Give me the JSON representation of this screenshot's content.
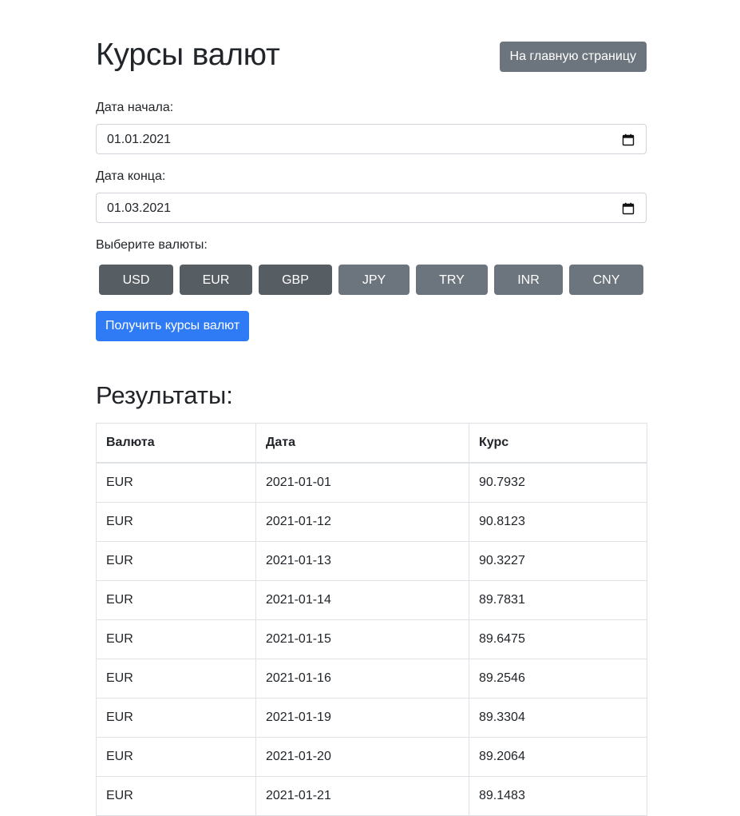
{
  "page": {
    "title": "Курсы валют",
    "home_button": "На главную страницу"
  },
  "form": {
    "start_label": "Дата начала:",
    "start_value": "01.01.2021",
    "end_label": "Дата конца:",
    "end_value": "01.03.2021",
    "currency_label": "Выберите валюты:",
    "currencies": [
      {
        "code": "USD",
        "selected": true
      },
      {
        "code": "EUR",
        "selected": true
      },
      {
        "code": "GBP",
        "selected": true
      },
      {
        "code": "JPY",
        "selected": false
      },
      {
        "code": "TRY",
        "selected": false
      },
      {
        "code": "INR",
        "selected": false
      },
      {
        "code": "CNY",
        "selected": false
      }
    ],
    "submit_button": "Получить курсы валют"
  },
  "results": {
    "title": "Результаты:",
    "columns": [
      "Валюта",
      "Дата",
      "Курс"
    ],
    "rows": [
      [
        "EUR",
        "2021-01-01",
        "90.7932"
      ],
      [
        "EUR",
        "2021-01-12",
        "90.8123"
      ],
      [
        "EUR",
        "2021-01-13",
        "90.3227"
      ],
      [
        "EUR",
        "2021-01-14",
        "89.7831"
      ],
      [
        "EUR",
        "2021-01-15",
        "89.6475"
      ],
      [
        "EUR",
        "2021-01-16",
        "89.2546"
      ],
      [
        "EUR",
        "2021-01-19",
        "89.3304"
      ],
      [
        "EUR",
        "2021-01-20",
        "89.2064"
      ],
      [
        "EUR",
        "2021-01-21",
        "89.1483"
      ]
    ]
  },
  "icons": {
    "calendar": "calendar-icon"
  },
  "colors": {
    "secondary": "#6c757d",
    "secondary_active": "#565e64",
    "primary": "#2f7bf6"
  }
}
